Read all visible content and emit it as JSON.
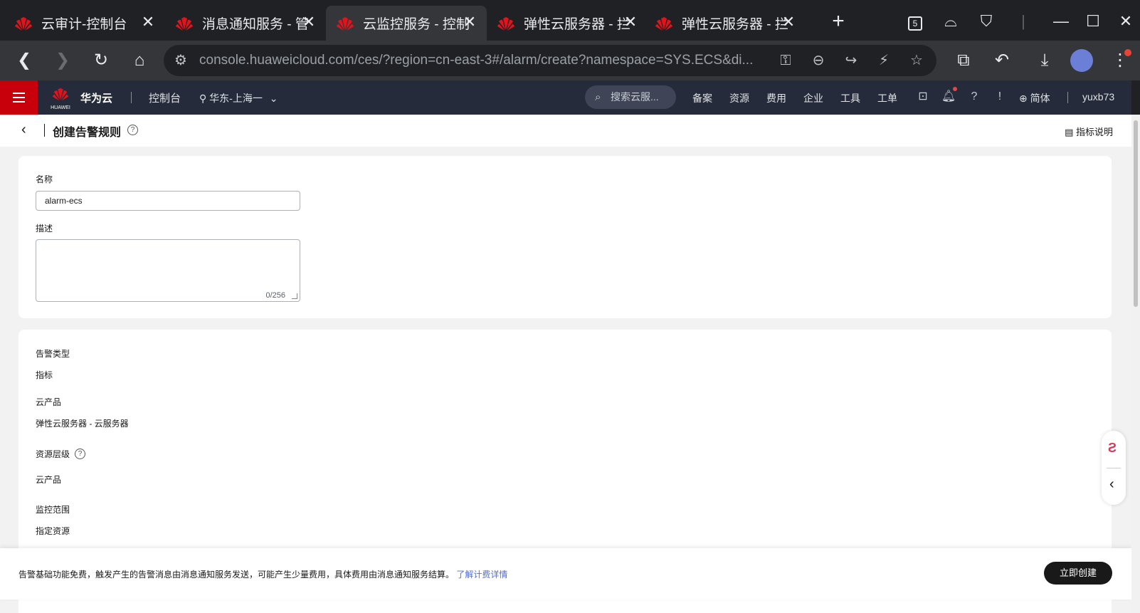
{
  "browser": {
    "tabs": [
      {
        "title": "云审计-控制台"
      },
      {
        "title": "消息通知服务 - 管"
      },
      {
        "title": "云监控服务 - 控制"
      },
      {
        "title": "弹性云服务器 - 拦"
      },
      {
        "title": "弹性云服务器 - 拦"
      }
    ],
    "tab_counter": "5",
    "url": "console.huaweicloud.com/ces/?region=cn-east-3#/alarm/create?namespace=SYS.ECS&di..."
  },
  "huawei": {
    "brand": "华为云",
    "logo_text": "HUAWEI",
    "console": "控制台",
    "region": "华东-上海一",
    "search_placeholder": "搜索云服...",
    "nav": [
      "备案",
      "资源",
      "费用",
      "企业",
      "工具",
      "工单"
    ],
    "language": "简体",
    "user": "yuxb73",
    "brand_color": "#c7000b"
  },
  "page": {
    "title": "创建告警规则",
    "metric_help": "指标说明"
  },
  "form": {
    "name_label": "名称",
    "name_value": "alarm-ecs",
    "desc_label": "描述",
    "desc_counter": "0/256",
    "alarm_type_label": "告警类型",
    "alarm_type_value": "指标",
    "product_label": "云产品",
    "product_value": "弹性云服务器 - 云服务器",
    "resource_level_label": "资源层级",
    "resource_level_value": "云产品",
    "scope_label": "监控范围",
    "scope_value": "指定资源"
  },
  "footer": {
    "notice": "告警基础功能免费，触发产生的告警消息由消息通知服务发送，可能产生少量费用，具体费用由消息通知服务结算。",
    "link": "了解计费详情",
    "create_button": "立即创建"
  }
}
